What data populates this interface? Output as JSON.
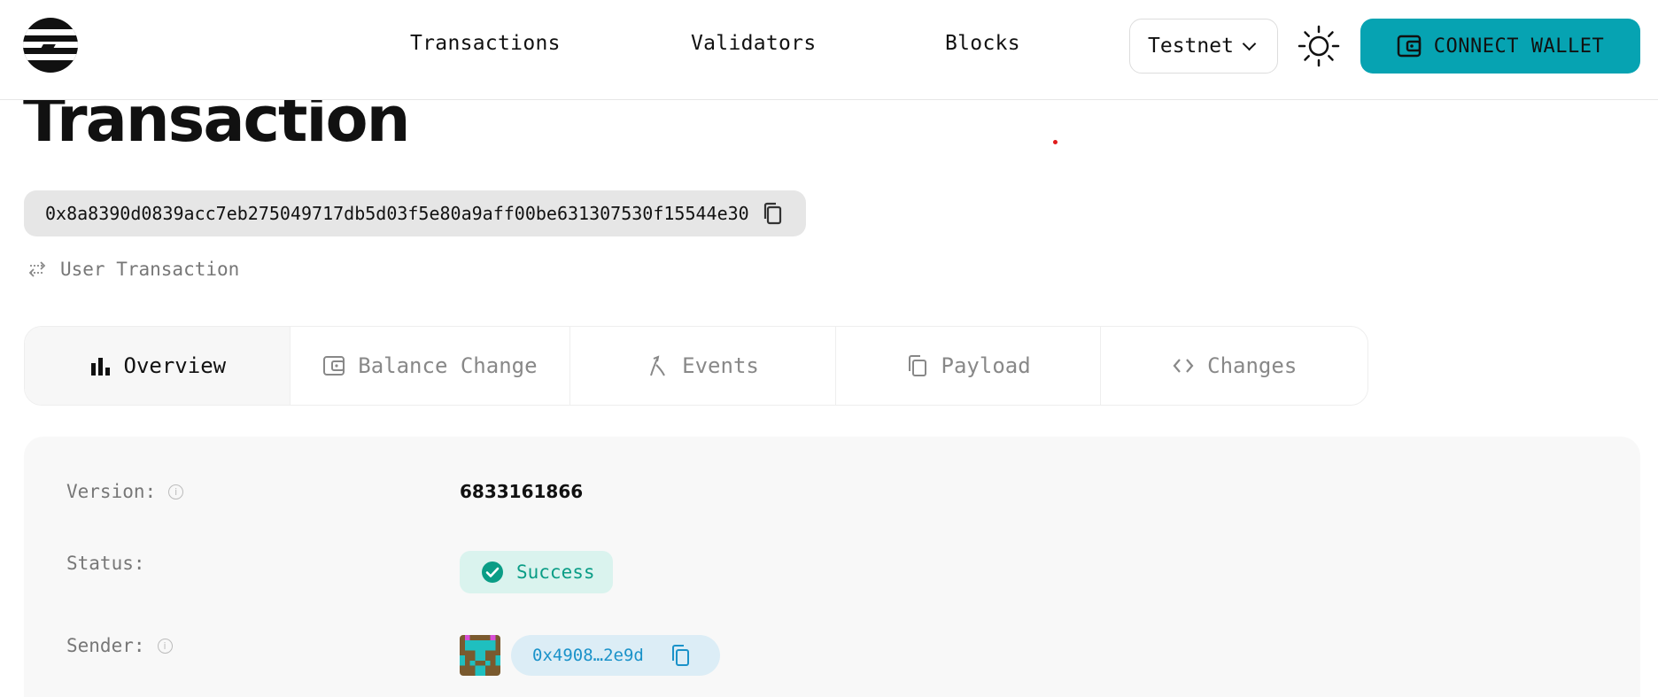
{
  "header": {
    "nav": {
      "transactions": "Transactions",
      "validators": "Validators",
      "blocks": "Blocks"
    },
    "network": "Testnet",
    "connect_wallet": "CONNECT WALLET",
    "accent_color": "#06a3b2"
  },
  "page": {
    "title": "Transaction",
    "hash": "0x8a8390d0839acc7eb275049717db5d03f5e80a9aff00be631307530f15544e30",
    "type_label": "User Transaction"
  },
  "tabs": [
    {
      "label": "Overview",
      "icon": "bar-chart-icon",
      "active": true
    },
    {
      "label": "Balance Change",
      "icon": "wallet-icon",
      "active": false
    },
    {
      "label": "Events",
      "icon": "merge-icon",
      "active": false
    },
    {
      "label": "Payload",
      "icon": "copy-icon",
      "active": false
    },
    {
      "label": "Changes",
      "icon": "code-icon",
      "active": false
    }
  ],
  "overview": {
    "version_label": "Version:",
    "version_value": "6833161866",
    "status_label": "Status:",
    "status_value": "Success",
    "status_color": "#0a9d86",
    "sender_label": "Sender:",
    "sender_value": "0x4908…2e9d"
  }
}
